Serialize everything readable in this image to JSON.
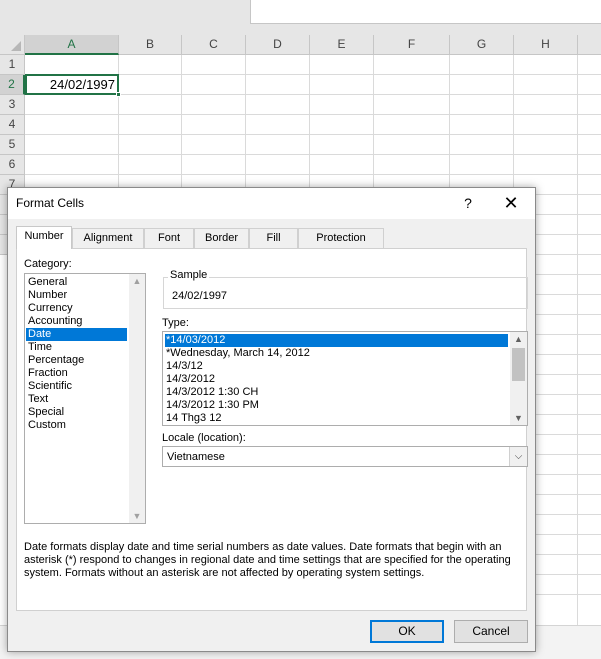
{
  "spreadsheet": {
    "columns": [
      "A",
      "B",
      "C",
      "D",
      "E",
      "F",
      "G",
      "H"
    ],
    "rows": [
      "1",
      "2",
      "3",
      "4",
      "5",
      "6",
      "7"
    ],
    "active_cell_value": "24/02/1997"
  },
  "dialog": {
    "title": "Format Cells",
    "help_glyph": "?",
    "close_glyph": "✕",
    "tabs": [
      "Number",
      "Alignment",
      "Font",
      "Border",
      "Fill",
      "Protection"
    ],
    "active_tab": "Number",
    "category_label": "Category:",
    "categories": [
      "General",
      "Number",
      "Currency",
      "Accounting",
      "Date",
      "Time",
      "Percentage",
      "Fraction",
      "Scientific",
      "Text",
      "Special",
      "Custom"
    ],
    "selected_category": "Date",
    "sample_label": "Sample",
    "sample_value": "24/02/1997",
    "type_label": "Type:",
    "types": [
      "*14/03/2012",
      "*Wednesday, March 14, 2012",
      "14/3/12",
      "14/3/2012",
      "14/3/2012 1:30 CH",
      "14/3/2012 1:30 PM",
      "14 Thg3 12"
    ],
    "selected_type": "*14/03/2012",
    "locale_label": "Locale (location):",
    "locale_value": "Vietnamese",
    "description": "Date formats display date and time serial numbers as date values.  Date formats that begin with an asterisk (*) respond to changes in regional date and time settings that are specified for the operating system. Formats without an asterisk are not affected by operating system settings.",
    "ok_label": "OK",
    "cancel_label": "Cancel"
  },
  "colors": {
    "accent": "#217346",
    "selection": "#0078d7"
  },
  "icons": {
    "help": "question-mark-icon",
    "close": "close-icon",
    "dropdown": "chevron-down-icon"
  }
}
